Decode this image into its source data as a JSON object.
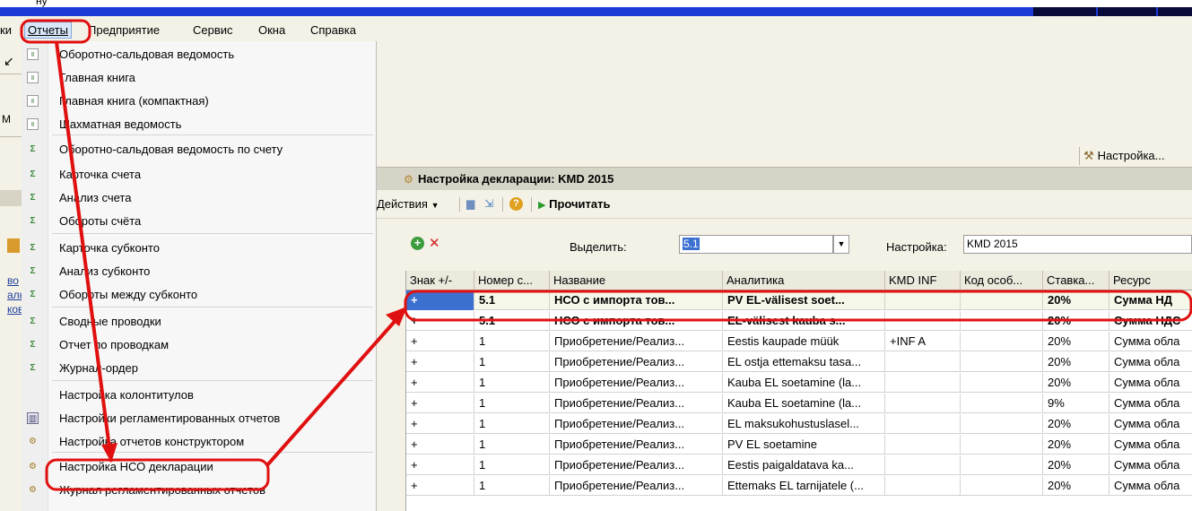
{
  "titlebar_frag": "ну",
  "menubar": {
    "prefix": "ки",
    "items": [
      {
        "label": "Отчеты",
        "active": true
      },
      {
        "label": "Предприятие"
      },
      {
        "label": "Сервис"
      },
      {
        "label": "Окна"
      },
      {
        "label": "Справка"
      }
    ]
  },
  "left_strip": {
    "frag_m": "М",
    "frag_vo": "во",
    "frag_al": "аль",
    "frag_kov": "ков"
  },
  "dropdown": {
    "items": [
      {
        "label": "Оборотно-сальдовая ведомость",
        "icon": "report-doc-icon"
      },
      {
        "label": "Главная книга",
        "icon": "report-doc-icon"
      },
      {
        "label": "Главная книга (компактная)",
        "icon": "report-doc-icon"
      },
      {
        "label": "Шахматная ведомость",
        "icon": "report-doc-icon"
      },
      {
        "label": "Оборотно-сальдовая ведомость по счету",
        "icon": "account-report-icon"
      },
      {
        "label": "Карточка счета",
        "icon": "account-report-icon"
      },
      {
        "label": "Анализ счета",
        "icon": "account-report-icon"
      },
      {
        "label": "Обороты счёта",
        "icon": "account-report-icon"
      },
      {
        "label": "Карточка субконто",
        "icon": "account-report-icon"
      },
      {
        "label": "Анализ субконто",
        "icon": "account-report-icon"
      },
      {
        "label": "Обороты между субконто",
        "icon": "account-report-icon"
      },
      {
        "label": "Сводные проводки",
        "icon": "account-report-icon"
      },
      {
        "label": "Отчет по проводкам",
        "icon": "account-report-icon"
      },
      {
        "label": "Журнал-ордер",
        "icon": "account-report-icon"
      },
      {
        "label": "Настройка колонтитулов",
        "icon": ""
      },
      {
        "label": "Настройки регламентированных отчетов",
        "icon": "grid-icon"
      },
      {
        "label": "Настройка отчетов конструктором",
        "icon": "settings-form-icon"
      },
      {
        "label": "Настройка НСО декларации",
        "icon": "settings-form-icon"
      },
      {
        "label": "Журнал регламентированных отчетов",
        "icon": "settings-form-icon"
      }
    ]
  },
  "top_right": {
    "settings_label": "Настройка..."
  },
  "form": {
    "title": "Настройка декларации: KMD 2015",
    "toolbar": {
      "actions_label": "Действия",
      "read_label": "Прочитать"
    },
    "filter": {
      "select_label": "Выделить:",
      "select_value": "5.1",
      "setting_label": "Настройка:",
      "setting_value": "KMD 2015"
    },
    "table": {
      "columns": [
        "Знак +/-",
        "Номер с...",
        "Название",
        "Аналитика",
        "KMD INF",
        "Код особ...",
        "Ставка...",
        "Ресурс"
      ],
      "rows": [
        [
          "+",
          "5.1",
          "НСО с импорта тов...",
          "PV EL-välisest soet...",
          "",
          "",
          "20%",
          "Сумма НД"
        ],
        [
          "+",
          "5.1",
          "НСО с импорта тов...",
          "EL-välisest kauba s...",
          "",
          "",
          "20%",
          "Сумма НДС"
        ],
        [
          "+",
          "1",
          "Приобретение/Реализ...",
          "Eestis kaupade müük",
          "+INF A",
          "",
          "20%",
          "Сумма обла"
        ],
        [
          "+",
          "1",
          "Приобретение/Реализ...",
          "EL ostja ettemaksu tasa...",
          "",
          "",
          "20%",
          "Сумма обла"
        ],
        [
          "+",
          "1",
          "Приобретение/Реализ...",
          "Kauba EL soetamine (la...",
          "",
          "",
          "20%",
          "Сумма обла"
        ],
        [
          "+",
          "1",
          "Приобретение/Реализ...",
          "Kauba EL soetamine (la...",
          "",
          "",
          "9%",
          "Сумма обла"
        ],
        [
          "+",
          "1",
          "Приобретение/Реализ...",
          "EL maksukohustuslasel...",
          "",
          "",
          "20%",
          "Сумма обла"
        ],
        [
          "+",
          "1",
          "Приобретение/Реализ...",
          "PV EL soetamine",
          "",
          "",
          "20%",
          "Сумма обла"
        ],
        [
          "+",
          "1",
          "Приобретение/Реализ...",
          "Eestis paigaldatava ka...",
          "",
          "",
          "20%",
          "Сумма обла"
        ],
        [
          "+",
          "1",
          "Приобретение/Реализ...",
          "Ettemaks EL tarnijatele (...",
          "",
          "",
          "20%",
          "Сумма обла"
        ]
      ]
    }
  },
  "colors": {
    "annotation_red": "#e01010",
    "selection_blue": "#3b6fd0",
    "menu_highlight": "#d7e6f9"
  }
}
